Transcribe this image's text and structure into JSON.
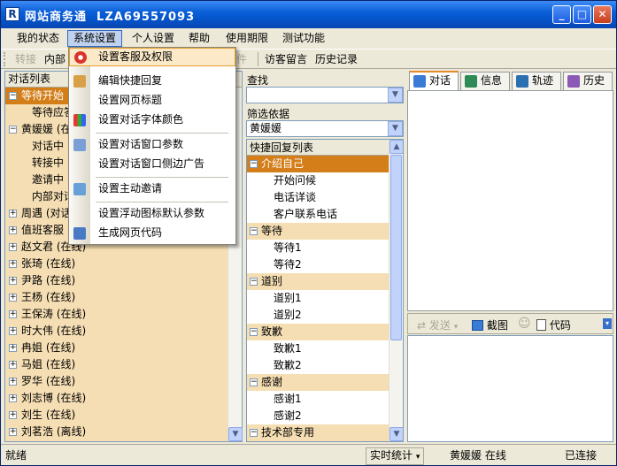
{
  "window": {
    "app_name": "网站商务通",
    "account": "LZA69557093",
    "title_full": "网站商务通  LZA69557093",
    "icon_letter": "R"
  },
  "menubar": {
    "items": [
      "我的状态",
      "系统设置",
      "个人设置",
      "帮助",
      "使用期限",
      "测试功能"
    ]
  },
  "toolbar": {
    "transfer": "转接",
    "internal": "内部",
    "file": "件",
    "visitor_message": "访客留言",
    "history": "历史记录"
  },
  "left_panel": {
    "header": "对话列表",
    "rows": [
      {
        "text": "等待开始",
        "level": 0,
        "expander": "−",
        "highlight": true
      },
      {
        "text": "等待应答",
        "level": 1
      },
      {
        "text": "黄媛媛  (在",
        "level": 0,
        "expander": "−"
      },
      {
        "text": "对话中",
        "level": 1
      },
      {
        "text": "转接中",
        "level": 1
      },
      {
        "text": "邀请中",
        "level": 1
      },
      {
        "text": "内部对话",
        "level": 1
      },
      {
        "text": "周遇  (对话",
        "level": 0,
        "expander": "+"
      },
      {
        "text": "值班客服",
        "level": 0,
        "expander": "+"
      },
      {
        "text": "赵文君  (在线)",
        "level": 0,
        "expander": "+"
      },
      {
        "text": "张琦  (在线)",
        "level": 0,
        "expander": "+"
      },
      {
        "text": "尹路  (在线)",
        "level": 0,
        "expander": "+"
      },
      {
        "text": "王杨  (在线)",
        "level": 0,
        "expander": "+"
      },
      {
        "text": "王保涛  (在线)",
        "level": 0,
        "expander": "+"
      },
      {
        "text": "时大伟  (在线)",
        "level": 0,
        "expander": "+"
      },
      {
        "text": "冉姐  (在线)",
        "level": 0,
        "expander": "+"
      },
      {
        "text": "马姐  (在线)",
        "level": 0,
        "expander": "+"
      },
      {
        "text": "罗华  (在线)",
        "level": 0,
        "expander": "+"
      },
      {
        "text": "刘志博  (在线)",
        "level": 0,
        "expander": "+"
      },
      {
        "text": "刘生  (在线)",
        "level": 0,
        "expander": "+"
      },
      {
        "text": "刘茗浩  (离线)",
        "level": 0,
        "expander": "+"
      }
    ]
  },
  "middle_panel": {
    "search_label": "查找",
    "search_value": "",
    "filter_label": "筛选依据",
    "filter_value": "黄媛媛",
    "list_header": "快捷回复列表",
    "rows": [
      {
        "text": "介绍自己",
        "group": true,
        "selected": true
      },
      {
        "text": "开始问候",
        "group": false
      },
      {
        "text": "电话详谈",
        "group": false
      },
      {
        "text": "客户联系电话",
        "group": false
      },
      {
        "text": "等待",
        "group": true
      },
      {
        "text": "等待1",
        "group": false
      },
      {
        "text": "等待2",
        "group": false
      },
      {
        "text": "道别",
        "group": true
      },
      {
        "text": "道别1",
        "group": false
      },
      {
        "text": "道别2",
        "group": false
      },
      {
        "text": "致歉",
        "group": true
      },
      {
        "text": "致歉1",
        "group": false
      },
      {
        "text": "致歉2",
        "group": false
      },
      {
        "text": "感谢",
        "group": true
      },
      {
        "text": "感谢1",
        "group": false
      },
      {
        "text": "感谢2",
        "group": false
      },
      {
        "text": "技术部专用",
        "group": true
      }
    ]
  },
  "right_panel": {
    "tabs": [
      {
        "label": "对话",
        "icon": "chat-icon",
        "color": "#3a7bd5"
      },
      {
        "label": "信息",
        "icon": "info-icon",
        "color": "#2e8b57"
      },
      {
        "label": "轨迹",
        "icon": "track-icon",
        "color": "#2a6fb0"
      },
      {
        "label": "历史",
        "icon": "history-icon",
        "color": "#8a5ab5"
      }
    ],
    "input_toolbar": {
      "send": "发送",
      "screenshot": "截图",
      "code": "代码"
    }
  },
  "status": {
    "ready": "就绪",
    "realtime_stats": "实时统计",
    "user_status": "黄媛媛  在线",
    "connection": "已连接"
  },
  "dropdown": {
    "items": [
      {
        "label": "设置客服及权限",
        "icon": "permission-icon",
        "highlight": true
      },
      {
        "label": "编辑快捷回复",
        "icon": "quick-reply-icon"
      },
      {
        "label": "设置网页标题",
        "icon": ""
      },
      {
        "label": "设置对话字体颜色",
        "icon": "font-color-icon"
      },
      {
        "label": "设置对话窗口参数",
        "icon": "window-params-icon"
      },
      {
        "label": "设置对话窗口侧边广告",
        "icon": ""
      },
      {
        "label": "设置主动邀请",
        "icon": "invite-icon"
      },
      {
        "label": "设置浮动图标默认参数",
        "icon": ""
      },
      {
        "label": "生成网页代码",
        "icon": "code-gen-icon"
      }
    ]
  },
  "colors": {
    "title_blue": "#0453c8",
    "highlight_orange": "#d47e1a",
    "tree_bg": "#f5deb3",
    "menu_hover": "#fbe9c8"
  }
}
